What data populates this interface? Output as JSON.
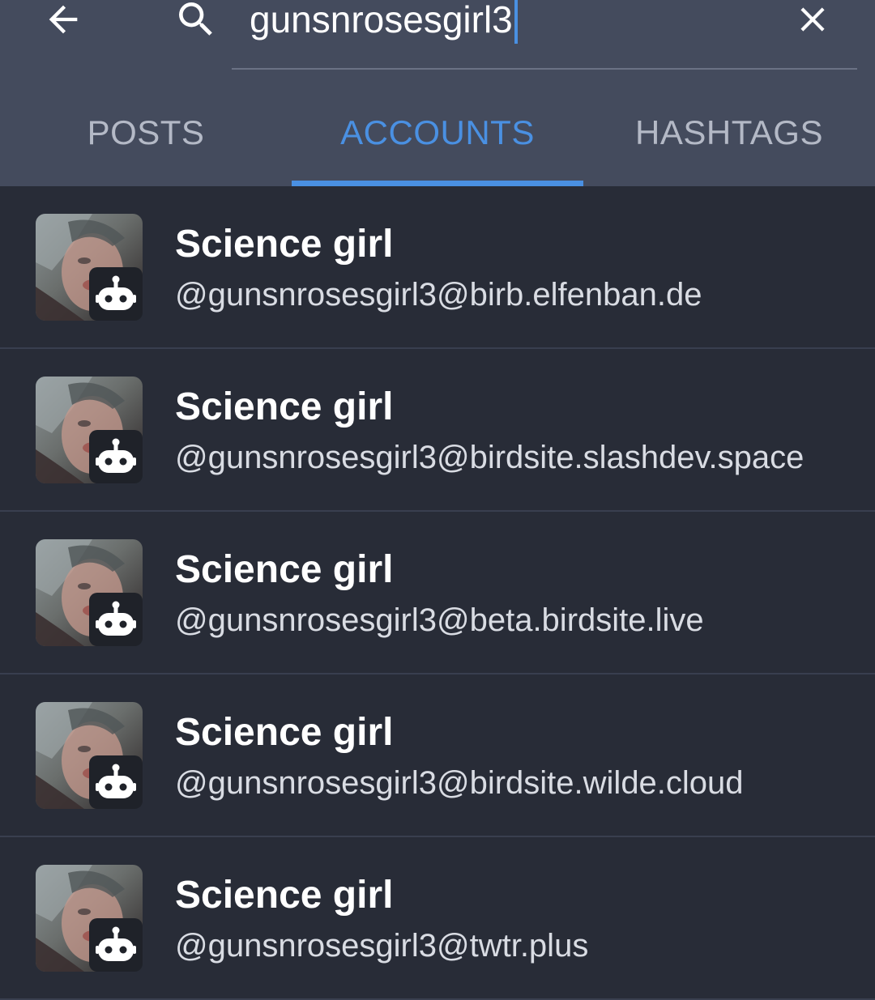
{
  "search": {
    "query": "gunsnrosesgirl3"
  },
  "icons": {
    "back": "arrow-left-icon",
    "search": "search-icon",
    "clear": "close-icon",
    "bot": "robot-icon"
  },
  "colors": {
    "header_bg": "#444b5d",
    "list_bg": "#282c37",
    "accent": "#4a90e2",
    "tab_inactive": "#b4b9c6"
  },
  "tabs": [
    {
      "label": "POSTS",
      "active": false
    },
    {
      "label": "ACCOUNTS",
      "active": true
    },
    {
      "label": "HASHTAGS",
      "active": false
    }
  ],
  "results": [
    {
      "display_name": "Science girl",
      "handle": "@gunsnrosesgirl3@birb.elfenban.de",
      "bot": true
    },
    {
      "display_name": "Science girl",
      "handle": "@gunsnrosesgirl3@birdsite.slashdev.space",
      "bot": true
    },
    {
      "display_name": "Science girl",
      "handle": "@gunsnrosesgirl3@beta.birdsite.live",
      "bot": true
    },
    {
      "display_name": "Science girl",
      "handle": "@gunsnrosesgirl3@birdsite.wilde.cloud",
      "bot": true
    },
    {
      "display_name": "Science girl",
      "handle": "@gunsnrosesgirl3@twtr.plus",
      "bot": true
    }
  ]
}
